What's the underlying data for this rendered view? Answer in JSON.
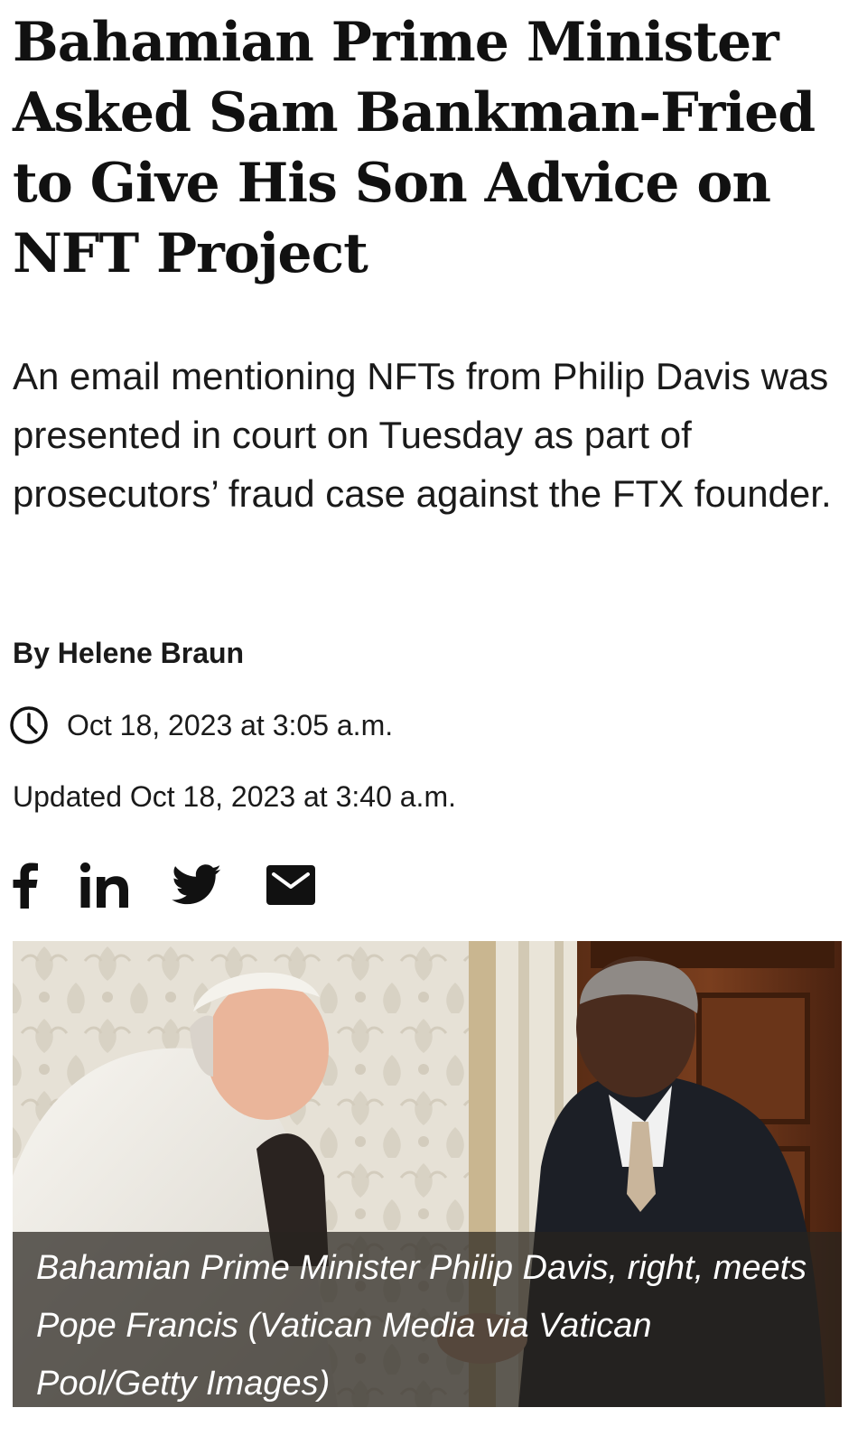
{
  "article": {
    "headline": "Bahamian Prime Minister Asked Sam Bankman-Fried to Give His Son Advice on NFT Project",
    "dek": "An email mentioning NFTs from Philip Davis was presented in court on Tuesday as part of prosecutors’ fraud case against the FTX founder.",
    "byline": "By Helene Braun",
    "published": "Oct 18, 2023 at 3:05 a.m.",
    "updated": "Updated Oct 18, 2023 at 3:40 a.m."
  },
  "share": {
    "icons": [
      "facebook-icon",
      "linkedin-icon",
      "twitter-icon",
      "email-icon"
    ],
    "color": "#111111"
  },
  "clock_icon": "clock-icon",
  "image": {
    "caption": "Bahamian Prime Minister Philip Davis, right, meets Pope Francis (Vatican Media via Vatican Pool/Getty Images)",
    "caption_bg": "#28241e"
  }
}
